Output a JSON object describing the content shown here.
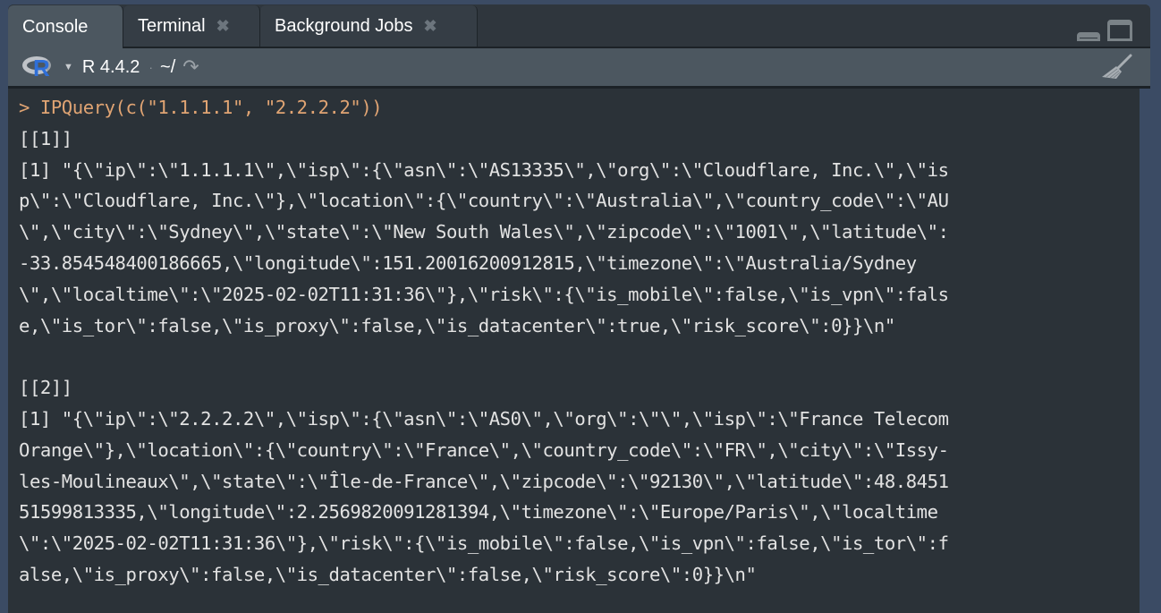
{
  "tabs": [
    {
      "label": "Console",
      "active": true,
      "closable": false
    },
    {
      "label": "Terminal",
      "active": false,
      "closable": true
    },
    {
      "label": "Background Jobs",
      "active": false,
      "closable": true
    }
  ],
  "tab_close_glyph": "✖",
  "toolbar": {
    "r_logo": "R",
    "r_version": "R 4.4.2",
    "separator": "·",
    "working_dir": "~/",
    "goto_icon": "↷"
  },
  "console": {
    "prompt": "> ",
    "command": "IPQuery(c(\"1.1.1.1\", \"2.2.2.2\"))",
    "output_lines": [
      "[[1]]",
      "[1] \"{\\\"ip\\\":\\\"1.1.1.1\\\",\\\"isp\\\":{\\\"asn\\\":\\\"AS13335\\\",\\\"org\\\":\\\"Cloudflare, Inc.\\\",\\\"is",
      "p\\\":\\\"Cloudflare, Inc.\\\"},\\\"location\\\":{\\\"country\\\":\\\"Australia\\\",\\\"country_code\\\":\\\"AU",
      "\\\",\\\"city\\\":\\\"Sydney\\\",\\\"state\\\":\\\"New South Wales\\\",\\\"zipcode\\\":\\\"1001\\\",\\\"latitude\\\":",
      "-33.854548400186665,\\\"longitude\\\":151.20016200912815,\\\"timezone\\\":\\\"Australia/Sydney",
      "\\\",\\\"localtime\\\":\\\"2025-02-02T11:31:36\\\"},\\\"risk\\\":{\\\"is_mobile\\\":false,\\\"is_vpn\\\":fals",
      "e,\\\"is_tor\\\":false,\\\"is_proxy\\\":false,\\\"is_datacenter\\\":true,\\\"risk_score\\\":0}}\\n\"",
      "",
      "[[2]]",
      "[1] \"{\\\"ip\\\":\\\"2.2.2.2\\\",\\\"isp\\\":{\\\"asn\\\":\\\"AS0\\\",\\\"org\\\":\\\"\\\",\\\"isp\\\":\\\"France Telecom",
      "Orange\\\"},\\\"location\\\":{\\\"country\\\":\\\"France\\\",\\\"country_code\\\":\\\"FR\\\",\\\"city\\\":\\\"Issy-",
      "les-Moulineaux\\\",\\\"state\\\":\\\"Île-de-France\\\",\\\"zipcode\\\":\\\"92130\\\",\\\"latitude\\\":48.8451",
      "51599813335,\\\"longitude\\\":2.2569820091281394,\\\"timezone\\\":\\\"Europe/Paris\\\",\\\"localtime",
      "\\\":\\\"2025-02-02T11:31:36\\\"},\\\"risk\\\":{\\\"is_mobile\\\":false,\\\"is_vpn\\\":false,\\\"is_tor\\\":f",
      "alse,\\\"is_proxy\\\":false,\\\"is_datacenter\\\":false,\\\"risk_score\\\":0}}\\n\""
    ]
  },
  "colors": {
    "command": "#e0a473",
    "output": "#e2e2e2",
    "console_bg": "#2b3238",
    "toolbar_bg": "#4c5760",
    "r_blue": "#2f6fd8"
  }
}
